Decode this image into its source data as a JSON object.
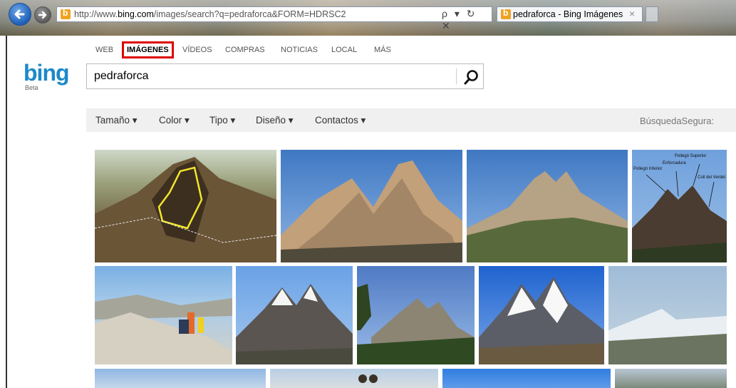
{
  "browser": {
    "url_prefix": "http://www.",
    "url_domain": "bing.com",
    "url_rest": "/images/search?q=pedraforca&FORM=HDRSC2",
    "tab_title": "pedraforca - Bing Imágenes",
    "tab_close": "×",
    "addr_icons": "ρ ▾ ↻ ✕"
  },
  "nav": {
    "web": "WEB",
    "images": "IMÁGENES",
    "videos": "VÍDEOS",
    "shopping": "COMPRAS",
    "news": "NOTICIAS",
    "local": "LOCAL",
    "more": "MÁS"
  },
  "logo": {
    "text": "bing",
    "beta": "Beta"
  },
  "search": {
    "value": "pedraforca"
  },
  "filters": {
    "size": "Tamaño ▾",
    "color": "Color ▾",
    "type": "Tipo ▾",
    "layout": "Diseño ▾",
    "people": "Contactos ▾",
    "safe": "BúsquedaSegura:"
  },
  "annotated_image_labels": [
    "Pollegó Superior",
    "Enforcadura",
    "Pollegó Inferior",
    "Coll del Verdet"
  ],
  "colors": {
    "accent": "#1c89c9",
    "highlight": "#dd0000"
  }
}
